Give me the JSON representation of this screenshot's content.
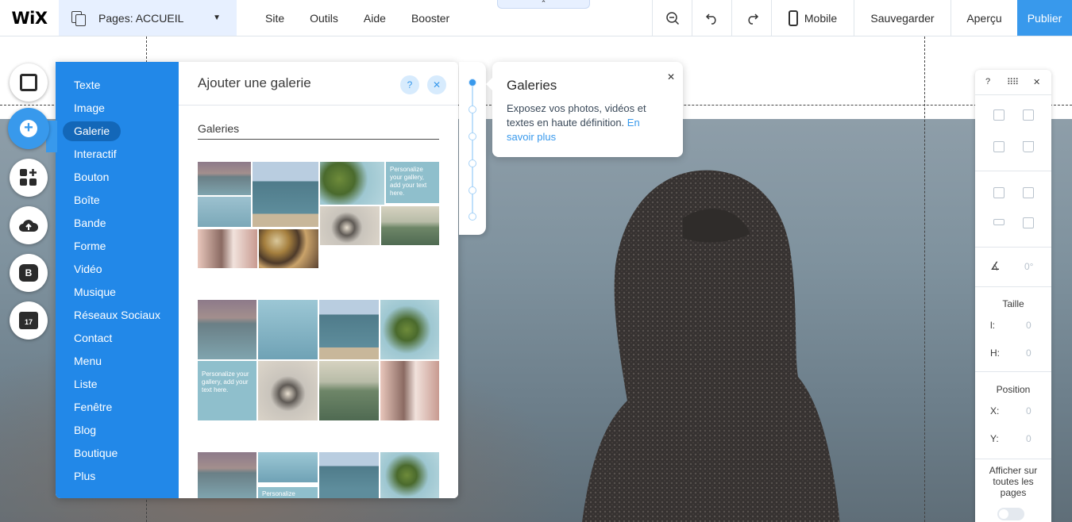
{
  "topbar": {
    "logo": "WiX",
    "pages_label": "Pages: ACCUEIL",
    "menu": [
      "Site",
      "Outils",
      "Aide",
      "Booster"
    ],
    "mobile_label": "Mobile",
    "save_label": "Sauvegarder",
    "preview_label": "Aperçu",
    "publish_label": "Publier",
    "collapse_glyph": "⌃"
  },
  "rail": {
    "items": [
      "background",
      "add",
      "add-apps",
      "upload",
      "blog",
      "bookings"
    ],
    "blog_badge": "B",
    "calendar_day": "17"
  },
  "addpanel": {
    "categories": [
      "Texte",
      "Image",
      "Galerie",
      "Interactif",
      "Bouton",
      "Boîte",
      "Bande",
      "Forme",
      "Vidéo",
      "Musique",
      "Réseaux Sociaux",
      "Contact",
      "Menu",
      "Liste",
      "Fenêtre",
      "Blog",
      "Boutique",
      "Plus"
    ],
    "active_category": "Galerie",
    "title": "Ajouter une galerie",
    "help": "?",
    "close": "✕",
    "section_title": "Galeries",
    "tile_text": "Personalize your gallery, add your text here.",
    "tile_text_short": "Personalize"
  },
  "tooltip": {
    "title": "Galeries",
    "text": "Exposez vos photos, vidéos et textes en haute définition.",
    "link": "En savoir plus",
    "close": "✕"
  },
  "right_toolbar": {
    "help": "?",
    "close": "✕",
    "angle_value": "0°",
    "size_label": "Taille",
    "width_key": "l:",
    "width_value": "0",
    "height_key": "H:",
    "height_value": "0",
    "position_label": "Position",
    "x_key": "X:",
    "x_value": "0",
    "y_key": "Y:",
    "y_value": "0",
    "show_all_pages_label": "Afficher sur toutes les pages",
    "show_all_pages_on": false
  },
  "colors": {
    "accent": "#3899ec",
    "panel_blue": "#2288e8",
    "panel_active": "#1367b8",
    "pages_bg": "#e7f0ff"
  }
}
